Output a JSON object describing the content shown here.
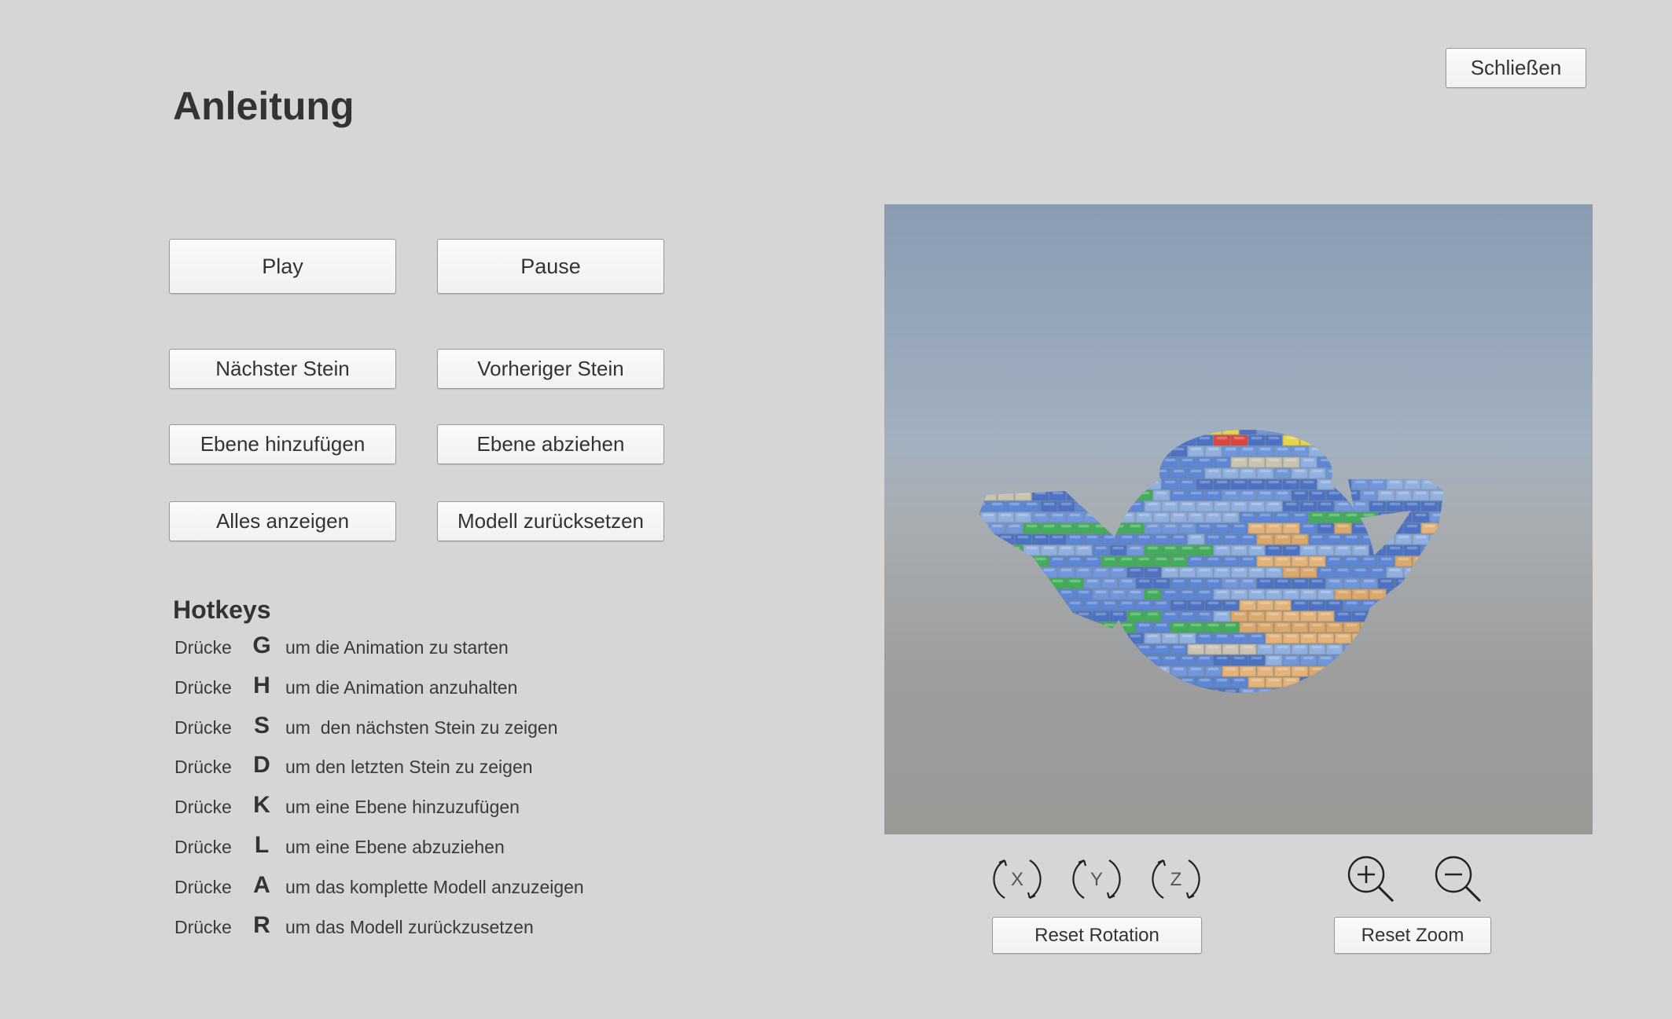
{
  "page": {
    "title": "Anleitung",
    "close_label": "Schließen"
  },
  "buttons": {
    "play": "Play",
    "pause": "Pause",
    "next_brick": "Nächster Stein",
    "prev_brick": "Vorheriger Stein",
    "add_layer": "Ebene hinzufügen",
    "remove_layer": "Ebene abziehen",
    "show_all": "Alles anzeigen",
    "reset_model": "Modell zurücksetzen"
  },
  "hotkeys": {
    "title": "Hotkeys",
    "items": [
      {
        "press": "Drücke",
        "key": "G",
        "desc": "um die Animation zu starten"
      },
      {
        "press": "Drücke",
        "key": "H",
        "desc": "um die Animation anzuhalten"
      },
      {
        "press": "Drücke",
        "key": "S",
        "desc": "um  den nächsten Stein zu zeigen"
      },
      {
        "press": "Drücke",
        "key": "D",
        "desc": "um den letzten Stein zu zeigen"
      },
      {
        "press": "Drücke",
        "key": "K",
        "desc": "um eine Ebene hinzuzufügen"
      },
      {
        "press": "Drücke",
        "key": "L",
        "desc": "um eine Ebene abzuziehen"
      },
      {
        "press": "Drücke",
        "key": "A",
        "desc": "um das komplette Modell anzuzeigen"
      },
      {
        "press": "Drücke",
        "key": "R",
        "desc": "um das Modell zurückzusetzen"
      }
    ]
  },
  "viewer": {
    "rotation_axes": [
      "X",
      "Y",
      "Z"
    ],
    "reset_rotation_label": "Reset Rotation",
    "reset_zoom_label": "Reset Zoom",
    "brick_colors": [
      "#5b86d6",
      "#6f96dc",
      "#4b72c4",
      "#e3b37a",
      "#d9a86a",
      "#3fae5a",
      "#e8d44a",
      "#d9463e",
      "#c9c3b0",
      "#8fb0e0"
    ]
  }
}
